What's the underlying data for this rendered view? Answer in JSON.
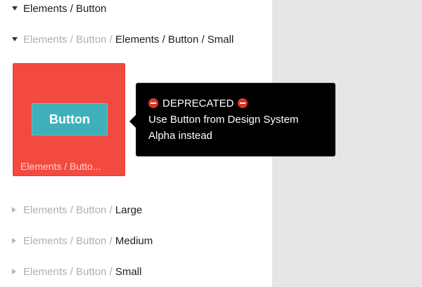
{
  "tree": {
    "item_top": {
      "label": "Elements / Button"
    },
    "item_expanded": {
      "prefix": "Elements / Button / ",
      "name": "Elements / Button / Small"
    },
    "thumbnail": {
      "button_label": "Button",
      "caption": "Elements / Butto..."
    },
    "children": [
      {
        "prefix": "Elements / Button / ",
        "name": "Large"
      },
      {
        "prefix": "Elements / Button / ",
        "name": "Medium"
      },
      {
        "prefix": "Elements / Button / ",
        "name": "Small"
      }
    ]
  },
  "tooltip": {
    "icon": "no-entry-icon",
    "title": "DEPRECATED",
    "line1": "Use Button from Design System",
    "line2": "Alpha instead"
  },
  "colors": {
    "thumbnail_bg": "#f24a40",
    "button_bg": "#3fb0b9",
    "tooltip_bg": "#000000",
    "right_panel_bg": "#e5e5e5"
  }
}
